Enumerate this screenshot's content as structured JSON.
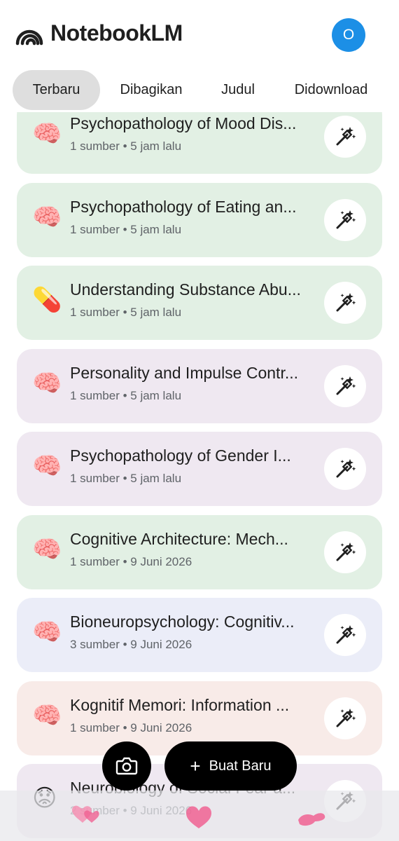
{
  "app": {
    "title": "NotebookLM",
    "avatar_letter": "O",
    "avatar_color": "#1c8fe6",
    "logo_icon": "notebooklm-logo-icon"
  },
  "tabs": [
    {
      "label": "Terbaru",
      "active": true
    },
    {
      "label": "Dibagikan",
      "active": false
    },
    {
      "label": "Judul",
      "active": false
    },
    {
      "label": "Didownload",
      "active": false
    }
  ],
  "notebooks": [
    {
      "emoji": "🧠",
      "title": "Psychopathology of Mood Dis...",
      "meta": "1 sumber • 5 jam lalu",
      "color": "#e2f0e4"
    },
    {
      "emoji": "🧠",
      "title": "Psychopathology of Eating an...",
      "meta": "1 sumber • 5 jam lalu",
      "color": "#e2f0e4"
    },
    {
      "emoji": "💊",
      "title": "Understanding Substance Abu...",
      "meta": "1 sumber • 5 jam lalu",
      "color": "#e2f0e4"
    },
    {
      "emoji": "🧠",
      "title": "Personality and Impulse Contr...",
      "meta": "1 sumber • 5 jam lalu",
      "color": "#efe8f1"
    },
    {
      "emoji": "🧠",
      "title": "Psychopathology of Gender I...",
      "meta": "1 sumber • 5 jam lalu",
      "color": "#efe8f1"
    },
    {
      "emoji": "🧠",
      "title": "Cognitive Architecture: Mech...",
      "meta": "1 sumber • 9 Juni 2026",
      "color": "#e2f0e4"
    },
    {
      "emoji": "🧠",
      "title": "Bioneuropsychology: Cognitiv...",
      "meta": "3 sumber • 9 Juni 2026",
      "color": "#ebedf8"
    },
    {
      "emoji": "🧠",
      "title": "Kognitif Memori: Information ...",
      "meta": "1 sumber • 9 Juni 2026",
      "color": "#f8ebe8"
    },
    {
      "emoji": "😟",
      "title": "Neurobiology of Social Fear a...",
      "meta": "2 sumber • 9 Juni 2026",
      "color": "#efe8f1"
    }
  ],
  "actions": {
    "camera_icon": "camera-icon",
    "new_label": "Buat Baru",
    "new_icon": "plus-icon"
  },
  "notebook_action_icon": "magic-wand-icon"
}
